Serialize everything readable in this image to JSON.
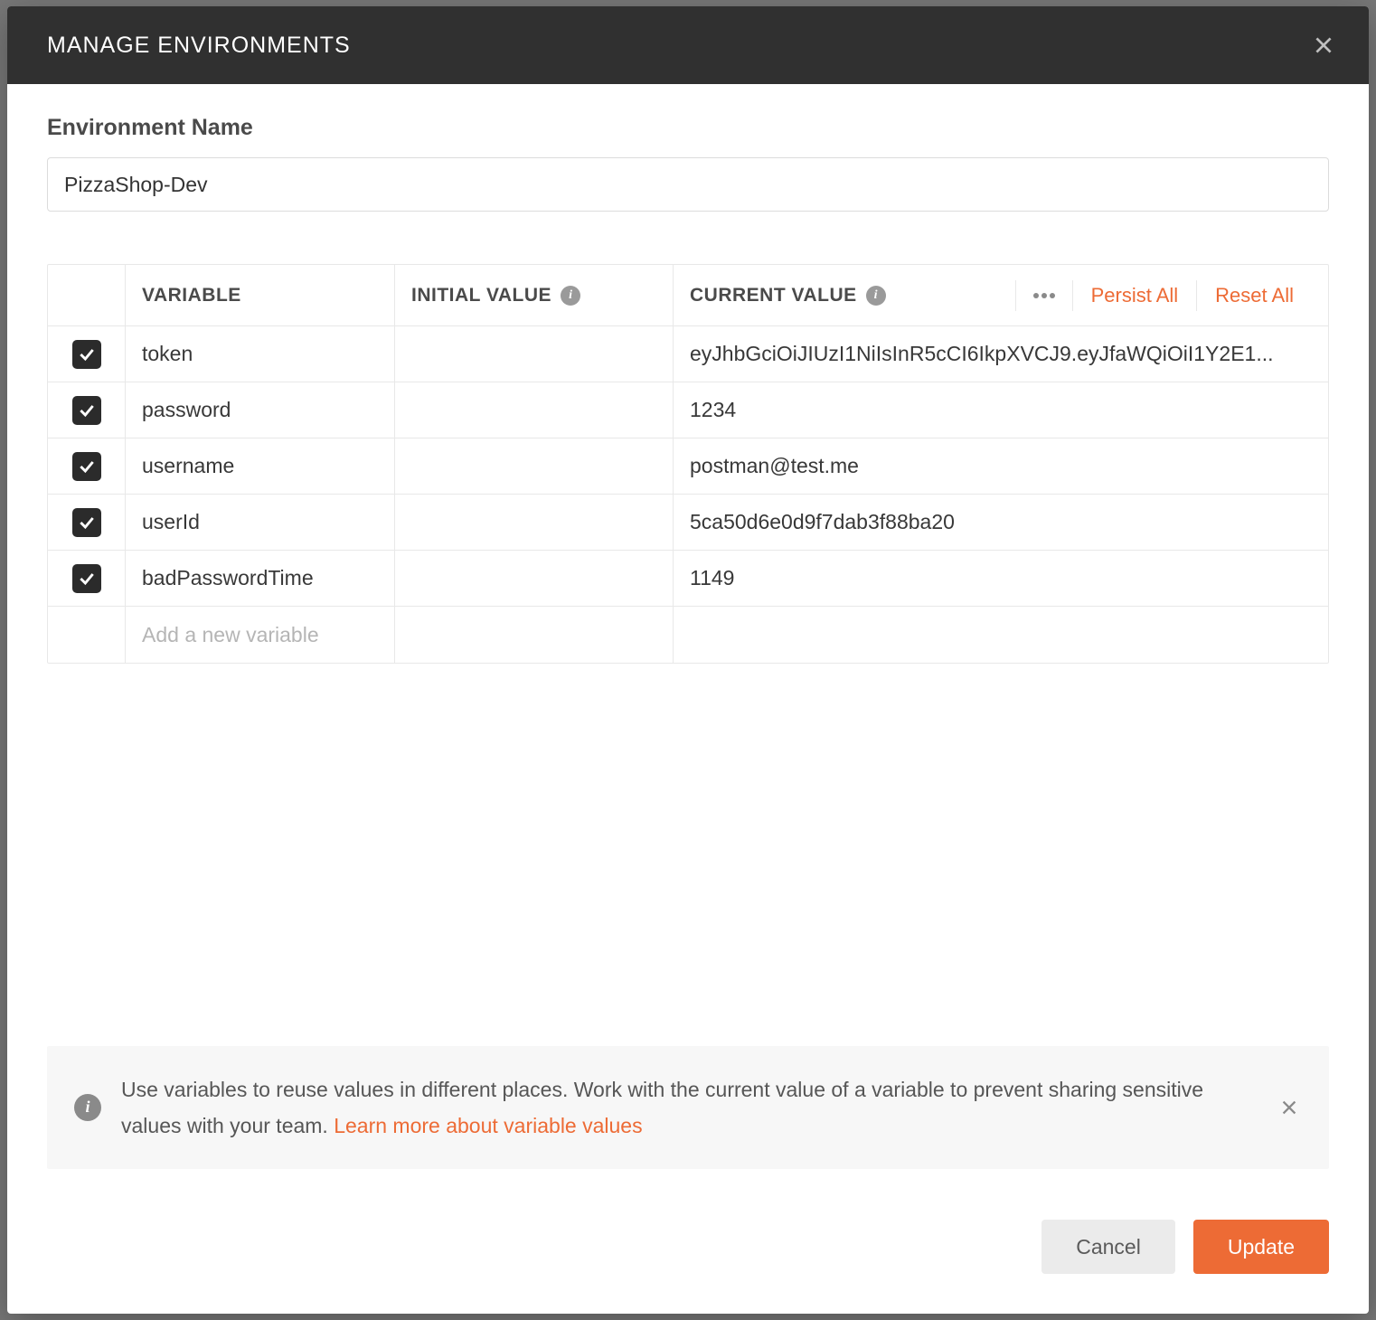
{
  "title": "MANAGE ENVIRONMENTS",
  "env_name_label": "Environment Name",
  "env_name_value": "PizzaShop-Dev",
  "table": {
    "headers": {
      "variable": "VARIABLE",
      "initial": "INITIAL VALUE",
      "current": "CURRENT VALUE"
    },
    "persist_all": "Persist All",
    "reset_all": "Reset All",
    "new_placeholder": "Add a new variable",
    "rows": [
      {
        "checked": true,
        "variable": "token",
        "initial": "",
        "current": "eyJhbGciOiJIUzI1NiIsInR5cCI6IkpXVCJ9.eyJfaWQiOiI1Y2E1..."
      },
      {
        "checked": true,
        "variable": "password",
        "initial": "",
        "current": "1234"
      },
      {
        "checked": true,
        "variable": "username",
        "initial": "",
        "current": "postman@test.me"
      },
      {
        "checked": true,
        "variable": "userId",
        "initial": "",
        "current": "5ca50d6e0d9f7dab3f88ba20"
      },
      {
        "checked": true,
        "variable": "badPasswordTime",
        "initial": "",
        "current": "1149"
      }
    ]
  },
  "notice": {
    "text_a": "Use variables to reuse values in different places. Work with the current value of a variable to prevent sharing sensitive values with your team. ",
    "link": "Learn more about variable values"
  },
  "footer": {
    "cancel": "Cancel",
    "update": "Update"
  }
}
